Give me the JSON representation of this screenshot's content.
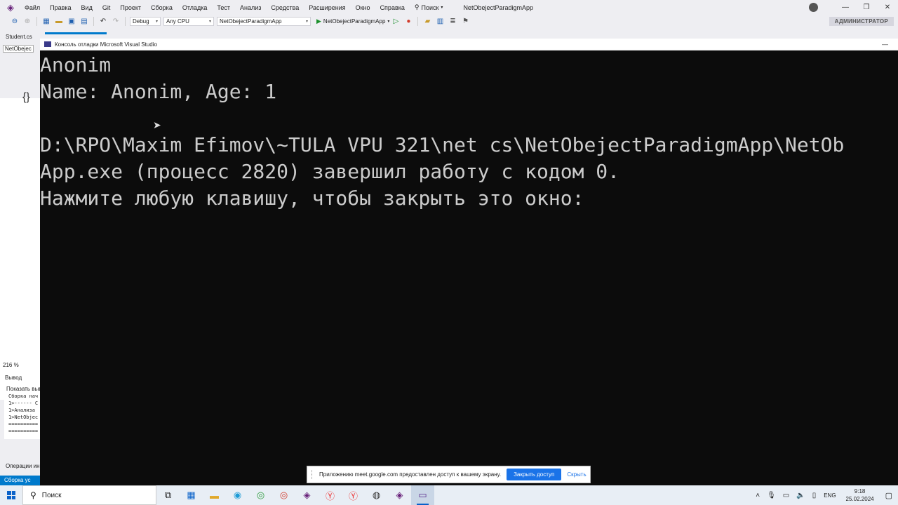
{
  "menubar": {
    "items": [
      "Файл",
      "Правка",
      "Вид",
      "Git",
      "Проект",
      "Сборка",
      "Отладка",
      "Тест",
      "Анализ",
      "Средства",
      "Расширения",
      "Окно",
      "Справка"
    ],
    "search_label": "Поиск",
    "solution_name": "NetObejectParadigmApp"
  },
  "toolbar": {
    "config": "Debug",
    "platform": "Any CPU",
    "project": "NetObejectParadigmApp",
    "run_label": "NetObejectParadigmApp",
    "admin_badge": "АДМИНИСТРАТОР"
  },
  "tabs": {
    "doc_tab": "Student.cs",
    "nav_label": "NetObejec"
  },
  "left_panel": {
    "zoom": "216 %",
    "output_title": "Вывод",
    "output_show": "Показать выв",
    "output_lines": [
      "Сборка нач",
      "1>------ С",
      "1>Анализа",
      "1>NetObjec",
      "==========",
      "=========="
    ],
    "ops": "Операции ин",
    "status": "Сборка ус"
  },
  "console": {
    "title": "Консоль отладки Microsoft Visual Studio",
    "lines": [
      "Anonim",
      "Name: Anonim, Age: 1",
      "",
      "D:\\RPO\\Maxim Efimov\\~TULA VPU 321\\net cs\\NetObejectParadigmApp\\NetOb",
      "App.exe (процесс 2820) завершил работу с кодом 0.",
      "Нажмите любую клавишу, чтобы закрыть это окно:"
    ]
  },
  "share_bar": {
    "message": "Приложению meet.google.com предоставлен доступ к вашему экрану.",
    "stop_label": "Закрыть доступ",
    "hide_label": "Скрыть"
  },
  "taskbar": {
    "search_placeholder": "Поиск",
    "lang": "ENG",
    "time": "9:18",
    "date": "25.02.2024"
  }
}
